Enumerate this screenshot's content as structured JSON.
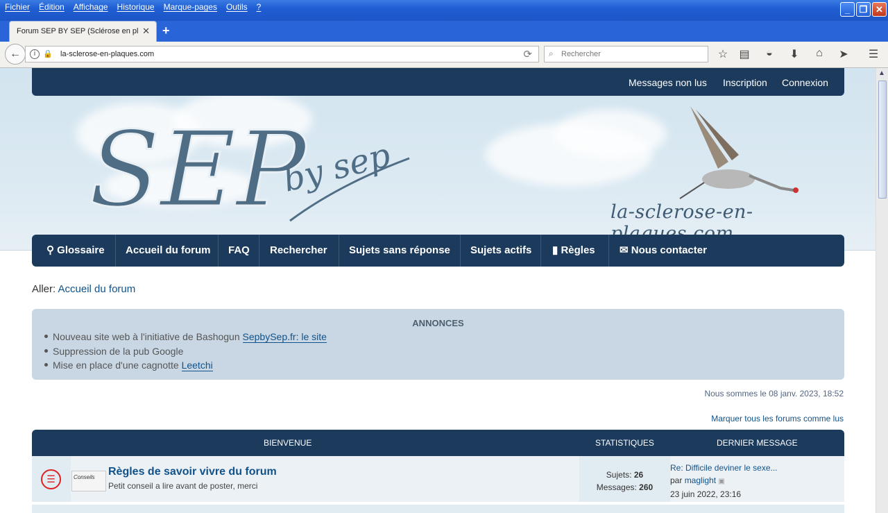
{
  "browser": {
    "menu": [
      "Fichier",
      "Édition",
      "Affichage",
      "Historique",
      "Marque-pages",
      "Outils",
      "?"
    ],
    "tab_title": "Forum SEP BY SEP (Sclérose en pl...",
    "url": "la-sclerose-en-plaques.com",
    "search_placeholder": "Rechercher"
  },
  "site": {
    "top_links": [
      "Messages non lus",
      "Inscription",
      "Connexion"
    ],
    "logo_main": "SEP",
    "logo_sub": "by sep",
    "site_name": "la-sclerose-en-plaques.com",
    "nav": [
      "Glossaire",
      "Accueil du forum",
      "FAQ",
      "Rechercher",
      "Sujets sans réponse",
      "Sujets actifs",
      "Règles",
      "Nous contacter"
    ],
    "aller_label": "Aller:",
    "aller_link": "Accueil du forum",
    "announcements": {
      "title": "ANNONCES",
      "items": [
        {
          "text": "Nouveau site web à l'initiative de Bashogun ",
          "link": "SepbySep.fr: le site"
        },
        {
          "text": "Suppression de la pub Google",
          "link": ""
        },
        {
          "text": "Mise en place d'une cagnotte ",
          "link": "Leetchi"
        }
      ]
    },
    "date_text": "Nous sommes le 08 janv. 2023, 18:52",
    "mark_read": "Marquer tous les forums comme lus",
    "forum_headers": {
      "welcome": "BIENVENUE",
      "stats": "STATISTIQUES",
      "last": "DERNIER MESSAGE"
    },
    "forums": [
      {
        "title": "Règles de savoir vivre du forum",
        "desc": "Petit conseil a lire avant de poster, merci",
        "thumb": "Conseils",
        "topics_label": "Sujets:",
        "topics": "26",
        "messages_label": "Messages:",
        "messages": "260",
        "last_title": "Re: Difficile deviner le sexe...",
        "last_by": "par",
        "last_user": "maglight",
        "last_date": "23 juin 2022, 23:16"
      }
    ]
  }
}
